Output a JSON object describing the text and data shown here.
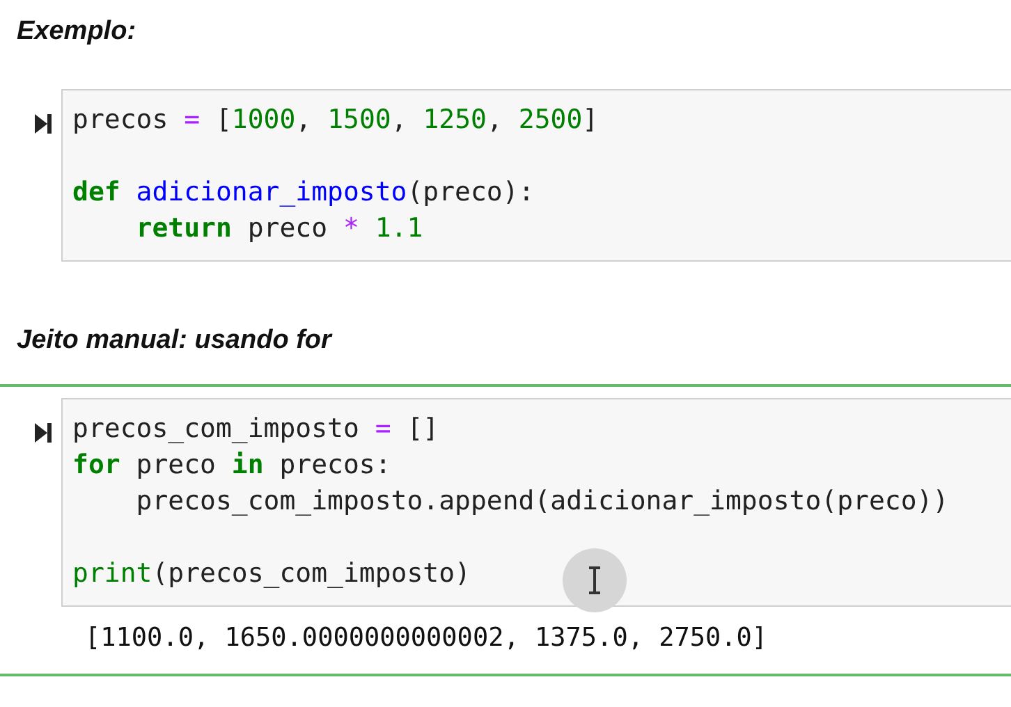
{
  "cells": [
    {
      "kind": "markdown",
      "heading": "Exemplo:"
    },
    {
      "kind": "code",
      "selected": false,
      "paragraphs": [
        [
          [
            {
              "t": "precos ",
              "kind": "plain"
            },
            {
              "t": "=",
              "kind": "operator"
            },
            {
              "t": " [",
              "kind": "plain"
            },
            {
              "t": "1000",
              "kind": "number"
            },
            {
              "t": ", ",
              "kind": "plain"
            },
            {
              "t": "1500",
              "kind": "number"
            },
            {
              "t": ", ",
              "kind": "plain"
            },
            {
              "t": "1250",
              "kind": "number"
            },
            {
              "t": ", ",
              "kind": "plain"
            },
            {
              "t": "2500",
              "kind": "number"
            },
            {
              "t": "]",
              "kind": "plain"
            }
          ]
        ],
        [
          [
            {
              "t": "def",
              "kind": "keyword"
            },
            {
              "t": " adicionar_imposto",
              "kind": "function"
            },
            {
              "t": "(preco):",
              "kind": "plain"
            }
          ],
          [
            {
              "t": "    return",
              "kind": "keyword"
            },
            {
              "t": " preco ",
              "kind": "plain"
            },
            {
              "t": "* ",
              "kind": "operator"
            },
            {
              "t": "1.1",
              "kind": "number"
            }
          ]
        ]
      ]
    },
    {
      "kind": "markdown",
      "heading": "Jeito manual: usando for"
    },
    {
      "kind": "code",
      "selected": true,
      "paragraphs": [
        [
          [
            {
              "t": "precos_com_imposto ",
              "kind": "plain"
            },
            {
              "t": "=",
              "kind": "operator"
            },
            {
              "t": " []",
              "kind": "plain"
            }
          ],
          [
            {
              "t": "for",
              "kind": "keyword"
            },
            {
              "t": " preco ",
              "kind": "plain"
            },
            {
              "t": "in",
              "kind": "keyword"
            },
            {
              "t": " precos:",
              "kind": "plain"
            }
          ],
          [
            {
              "t": "    precos_com_imposto.append(adicionar_imposto(preco))",
              "kind": "plain"
            }
          ]
        ],
        [
          [
            {
              "t": "print",
              "kind": "builtin"
            },
            {
              "t": "(precos_com_imposto)",
              "kind": "plain"
            }
          ]
        ]
      ],
      "output": "[1100.0, 1650.0000000000002, 1375.0, 2750.0]"
    }
  ]
}
